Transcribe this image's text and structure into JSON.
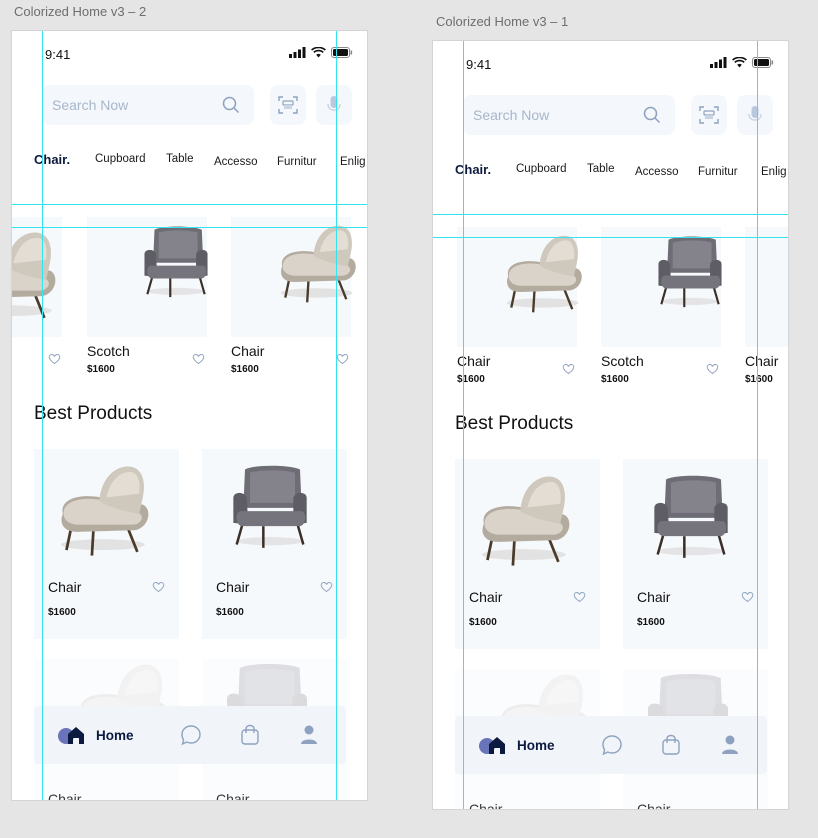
{
  "artboards": [
    {
      "label": "Colorized Home v3 – 2",
      "status_time": "9:41",
      "search_placeholder": "Search Now",
      "categories": [
        "Chair.",
        "Cupboard",
        "Table",
        "Accesso",
        "Furnitur",
        "Enlig"
      ],
      "top_products": [
        {
          "name": "",
          "price": ""
        },
        {
          "name": "Scotch",
          "price": "$1600"
        },
        {
          "name": "Chair",
          "price": "$1600"
        }
      ],
      "section_title": "Best Products",
      "best_products": [
        {
          "name": "Chair",
          "price": "$1600",
          "color": "beige"
        },
        {
          "name": "Chair",
          "price": "$1600",
          "color": "gray"
        }
      ],
      "ghost_products": [
        {
          "name": "Chair"
        },
        {
          "name": "Chair"
        }
      ],
      "nav": {
        "home_label": "Home"
      }
    },
    {
      "label": "Colorized Home v3 – 1",
      "status_time": "9:41",
      "search_placeholder": "Search Now",
      "categories": [
        "Chair.",
        "Cupboard",
        "Table",
        "Accesso",
        "Furnitur",
        "Enlig"
      ],
      "top_products": [
        {
          "name": "Chair",
          "price": "$1600"
        },
        {
          "name": "Scotch",
          "price": "$1600"
        },
        {
          "name": "Chair",
          "price": "$1600"
        }
      ],
      "section_title": "Best Products",
      "best_products": [
        {
          "name": "Chair",
          "price": "$1600",
          "color": "beige"
        },
        {
          "name": "Chair",
          "price": "$1600",
          "color": "gray"
        }
      ],
      "ghost_products": [
        {
          "name": "Chair"
        },
        {
          "name": "Chair"
        }
      ],
      "nav": {
        "home_label": "Home"
      }
    }
  ],
  "colors": {
    "guide": "#33e3ee",
    "nav_accent": "#0d1a40",
    "card_bg": "#f6f9fc",
    "icon_muted": "#8ea2bf"
  },
  "icons": [
    "search-icon",
    "scan-icon",
    "mic-icon",
    "home-icon",
    "chat-icon",
    "bag-icon",
    "user-icon",
    "heart-icon",
    "signal-icon",
    "wifi-icon",
    "battery-icon"
  ]
}
